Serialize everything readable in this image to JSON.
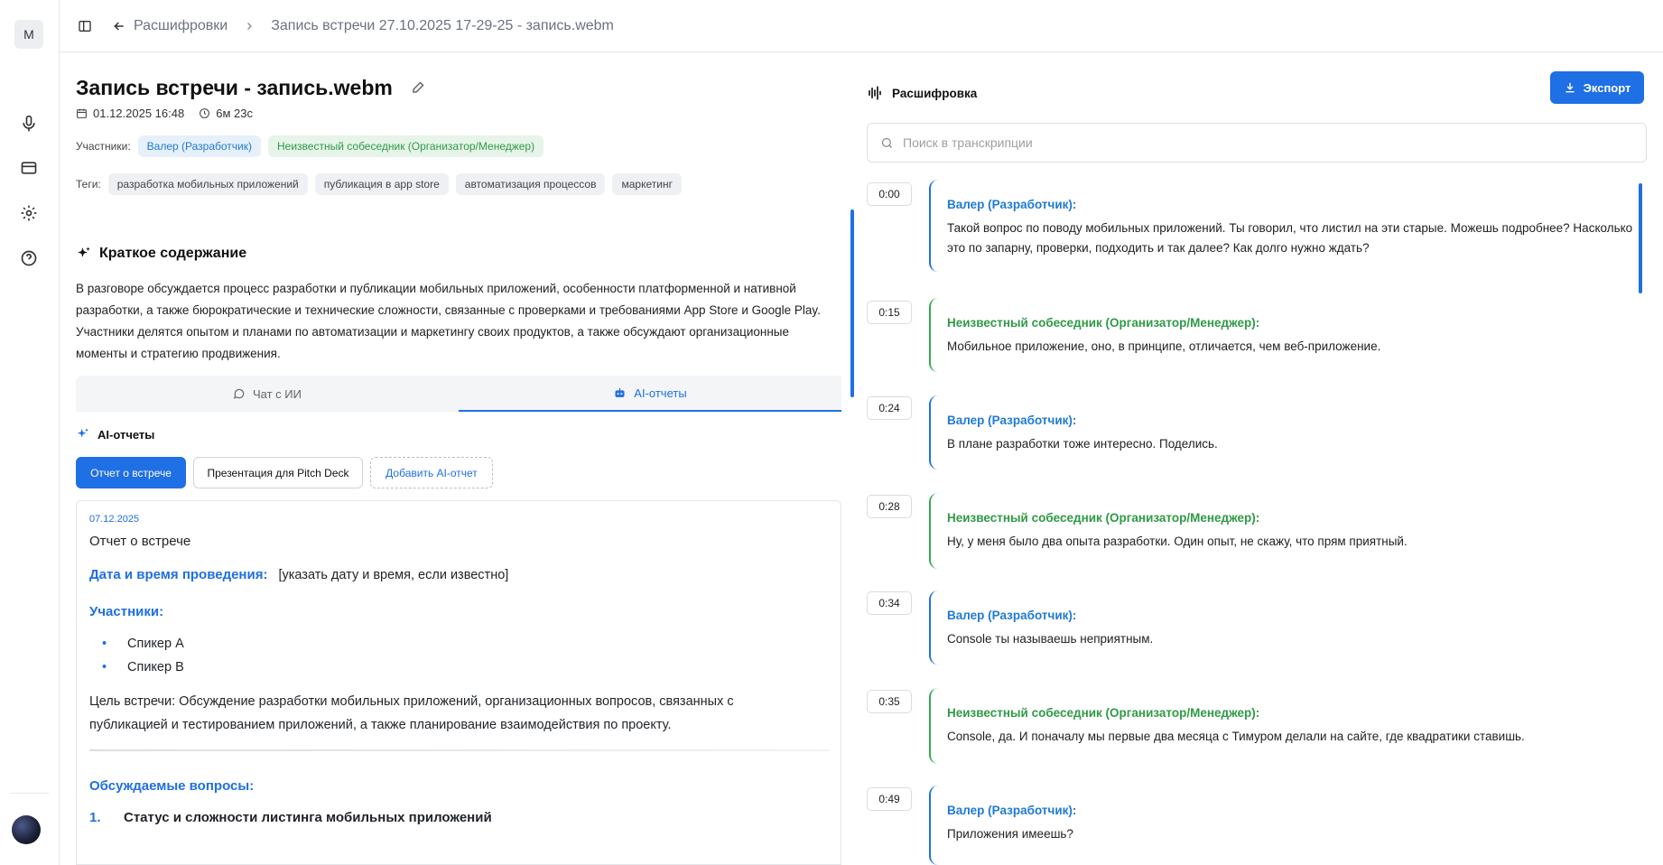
{
  "sidebar": {
    "workspace_initial": "М",
    "items": [
      "mic-icon",
      "card-icon",
      "gear-icon",
      "help-icon"
    ]
  },
  "breadcrumb": {
    "back": "Расшифровки",
    "current": "Запись встречи 27.10.2025 17-29-25 - запись.webm"
  },
  "meeting": {
    "title": "Запись встречи - запись.webm",
    "date": "01.12.2025 16:48",
    "duration": "6м 23с",
    "participants_label": "Участники:",
    "participants": [
      {
        "name": "Валер (Разработчик)",
        "color": "#1f7ad6"
      },
      {
        "name": "Неизвестный собеседник (Организатор/Менеджер)",
        "color": "#2f9a46"
      }
    ],
    "tags_label": "Теги:",
    "tags": [
      "разработка мобильных приложений",
      "публикация в app store",
      "автоматизация процессов",
      "маркетинг"
    ]
  },
  "summary": {
    "title": "Краткое содержание",
    "text": "В разговоре обсуждается процесс разработки и публикации мобильных приложений, особенности платформенной и нативной разработки, а также бюрократические и технические сложности, связанные с проверками и требованиями App Store и Google Play. Участники делятся опытом и планами по автоматизации и маркетингу своих продуктов, а также обсуждают организационные моменты и стратегию продвижения."
  },
  "tabs": [
    {
      "label": "Чат с ИИ",
      "active": false
    },
    {
      "label": "AI-отчеты",
      "active": true
    }
  ],
  "ai_reports": {
    "title": "AI-отчеты",
    "buttons": [
      "Отчет о встрече",
      "Презентация для Pitch Deck",
      "Добавить AI-отчет"
    ],
    "report": {
      "date": "07.12.2025",
      "heading": "Отчет о встрече",
      "datetime_label": "Дата и время проведения:",
      "datetime_value": "[указать дату и время, если известно]",
      "participants_label": "Участники:",
      "participants": [
        "Спикер A",
        "Спикер B"
      ],
      "goal": "Цель встречи: Обсуждение разработки мобильных приложений, организационных вопросов, связанных с публикацией и тестированием приложений, а также планирование взаимодействия по проекту.",
      "issues_label": "Обсуждаемые вопросы:",
      "issue_1_num": "1.",
      "issue_1": "Статус и сложности листинга мобильных приложений"
    }
  },
  "transcript": {
    "title": "Расшифровка",
    "export_label": "Экспорт",
    "search_placeholder": "Поиск в транскрипции",
    "entries": [
      {
        "time": "0:00",
        "speaker": "Валер (Разработчик):",
        "text": "Такой вопрос по поводу мобильных приложений. Ты говорил, что листил на эти старые. Можешь подробнее? Насколько это по запарну, проверки, подходить и так далее? Как долго нужно ждать?",
        "green": false
      },
      {
        "time": "0:15",
        "speaker": "Неизвестный собеседник (Организатор/Менеджер):",
        "text": "Мобильное приложение, оно, в принципе, отличается, чем веб-приложение.",
        "green": true
      },
      {
        "time": "0:24",
        "speaker": "Валер (Разработчик):",
        "text": "В плане разработки тоже интересно. Поделись.",
        "green": false
      },
      {
        "time": "0:28",
        "speaker": "Неизвестный собеседник (Организатор/Менеджер):",
        "text": "Ну, у меня было два опыта разработки. Один опыт, не скажу, что прям приятный.",
        "green": true
      },
      {
        "time": "0:34",
        "speaker": "Валер (Разработчик):",
        "text": "Console ты называешь неприятным.",
        "green": false
      },
      {
        "time": "0:35",
        "speaker": "Неизвестный собеседник (Организатор/Менеджер):",
        "text": "Console, да. И поначалу мы первые два месяца с Тимуром делали на сайте, где квадратики ставишь.",
        "green": true
      },
      {
        "time": "0:49",
        "speaker": "Валер (Разработчик):",
        "text": "Приложения имеешь?",
        "green": false
      }
    ]
  },
  "colors": {
    "accent": "#1f6fe5",
    "speaker_blue": "#1f7ad6",
    "speaker_green": "#2f9a46"
  }
}
